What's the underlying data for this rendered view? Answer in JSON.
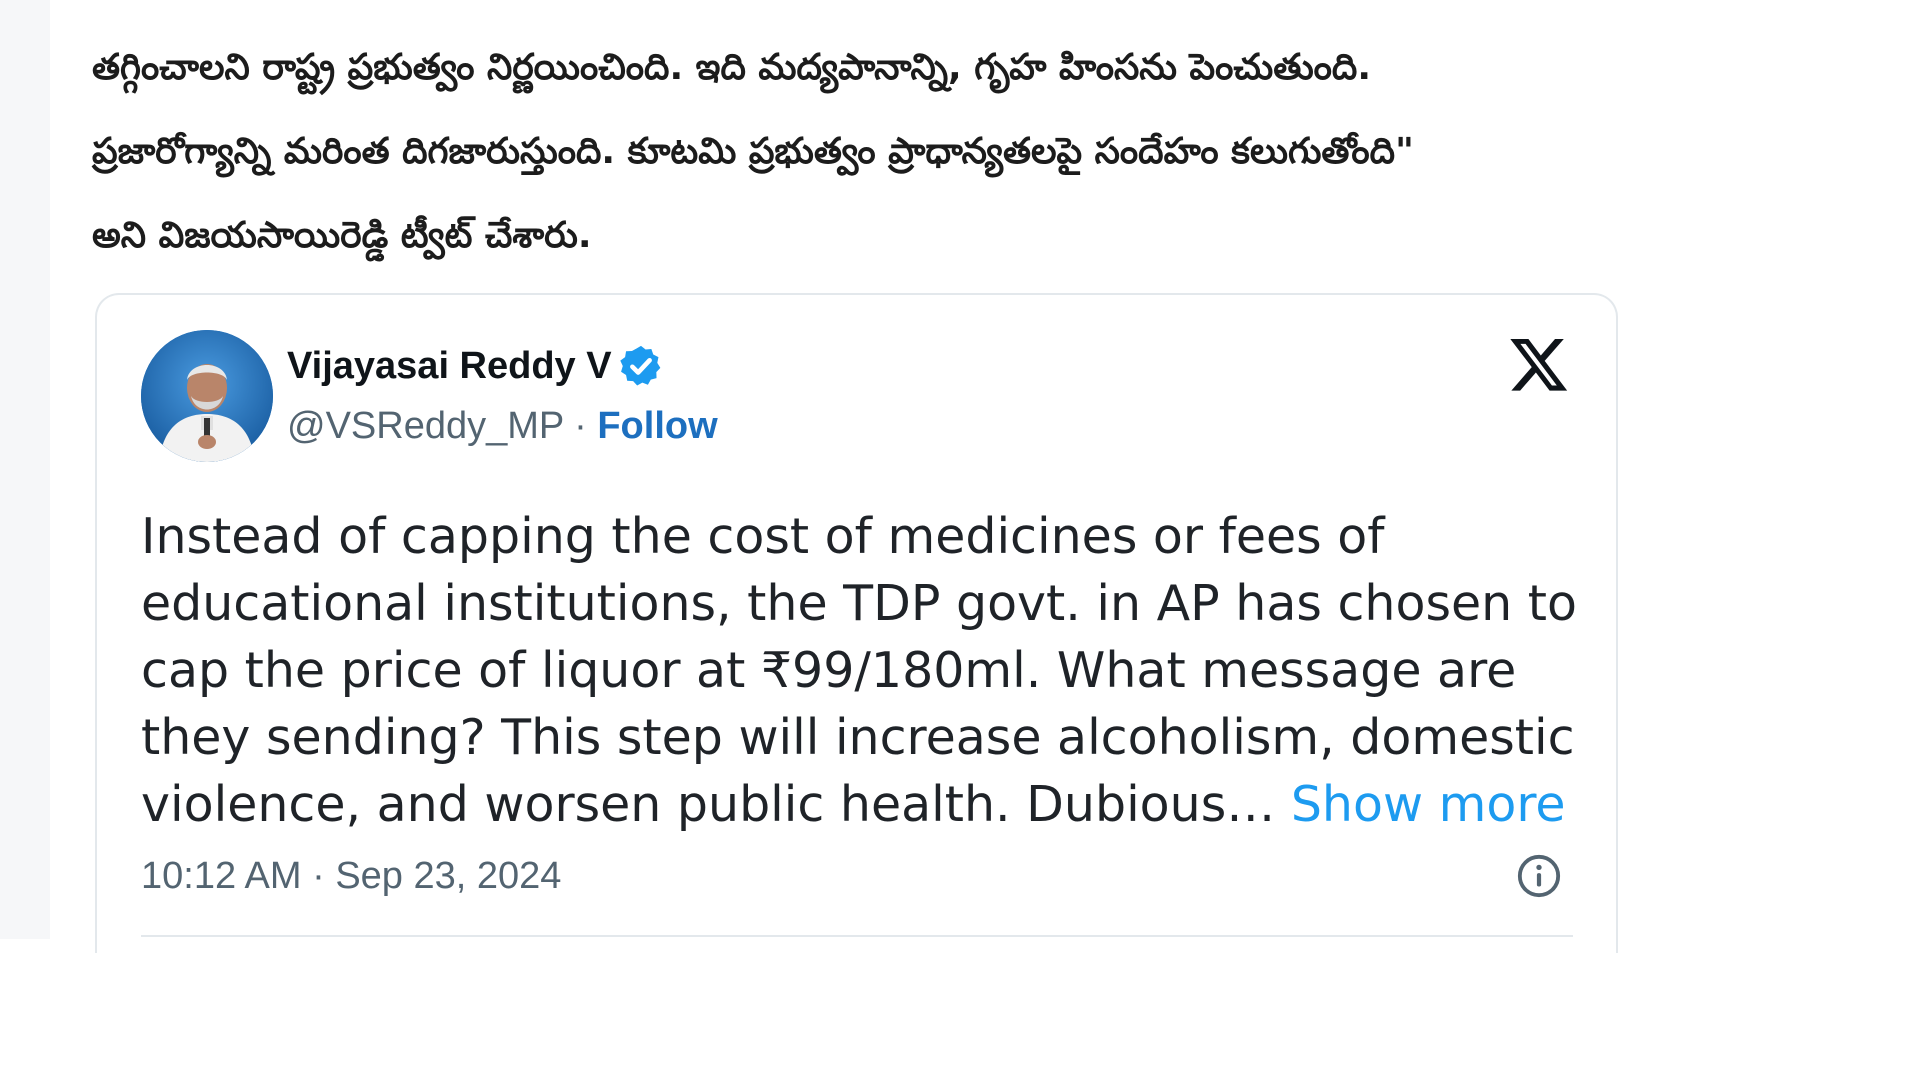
{
  "article": {
    "lines": [
      "తగ్గించాలని రాష్ట్ర ప్రభుత్వం నిర్ణయించింది. ఇది మద్యపానాన్ని, గృహ హింసను పెంచుతుంది.",
      "ప్రజారోగ్యాన్ని మరింత దిగజారుస్తుంది. కూటమి ప్రభుత్వం ప్రాధాన్యతలపై సందేహం కలుగుతోంది\"",
      "అని విజయసాయిరెడ్డి ట్వీట్ చేశారు."
    ]
  },
  "tweet": {
    "author_name": "Vijayasai Reddy V",
    "handle": "@VSReddy_MP",
    "separator": " · ",
    "follow_label": "Follow",
    "text_lines": [
      "Instead of capping the cost of medicines or fees of",
      "educational institutions, the TDP govt. in AP has chosen to",
      "cap the price of liquor at ₹99/180ml. What message are",
      "they sending? This step will increase alcoholism, domestic"
    ],
    "text_last_line": "violence, and worsen public health. Dubious… ",
    "show_more_label": "Show more",
    "timestamp": "10:12 AM · Sep 23, 2024",
    "icons": {
      "verified": "verified-badge-icon",
      "platform": "x-logo-icon",
      "info": "info-icon"
    }
  },
  "colors": {
    "link": "#1d9bf0",
    "follow": "#1d6fbf",
    "verified": "#1d9bf0",
    "muted": "#536471"
  }
}
